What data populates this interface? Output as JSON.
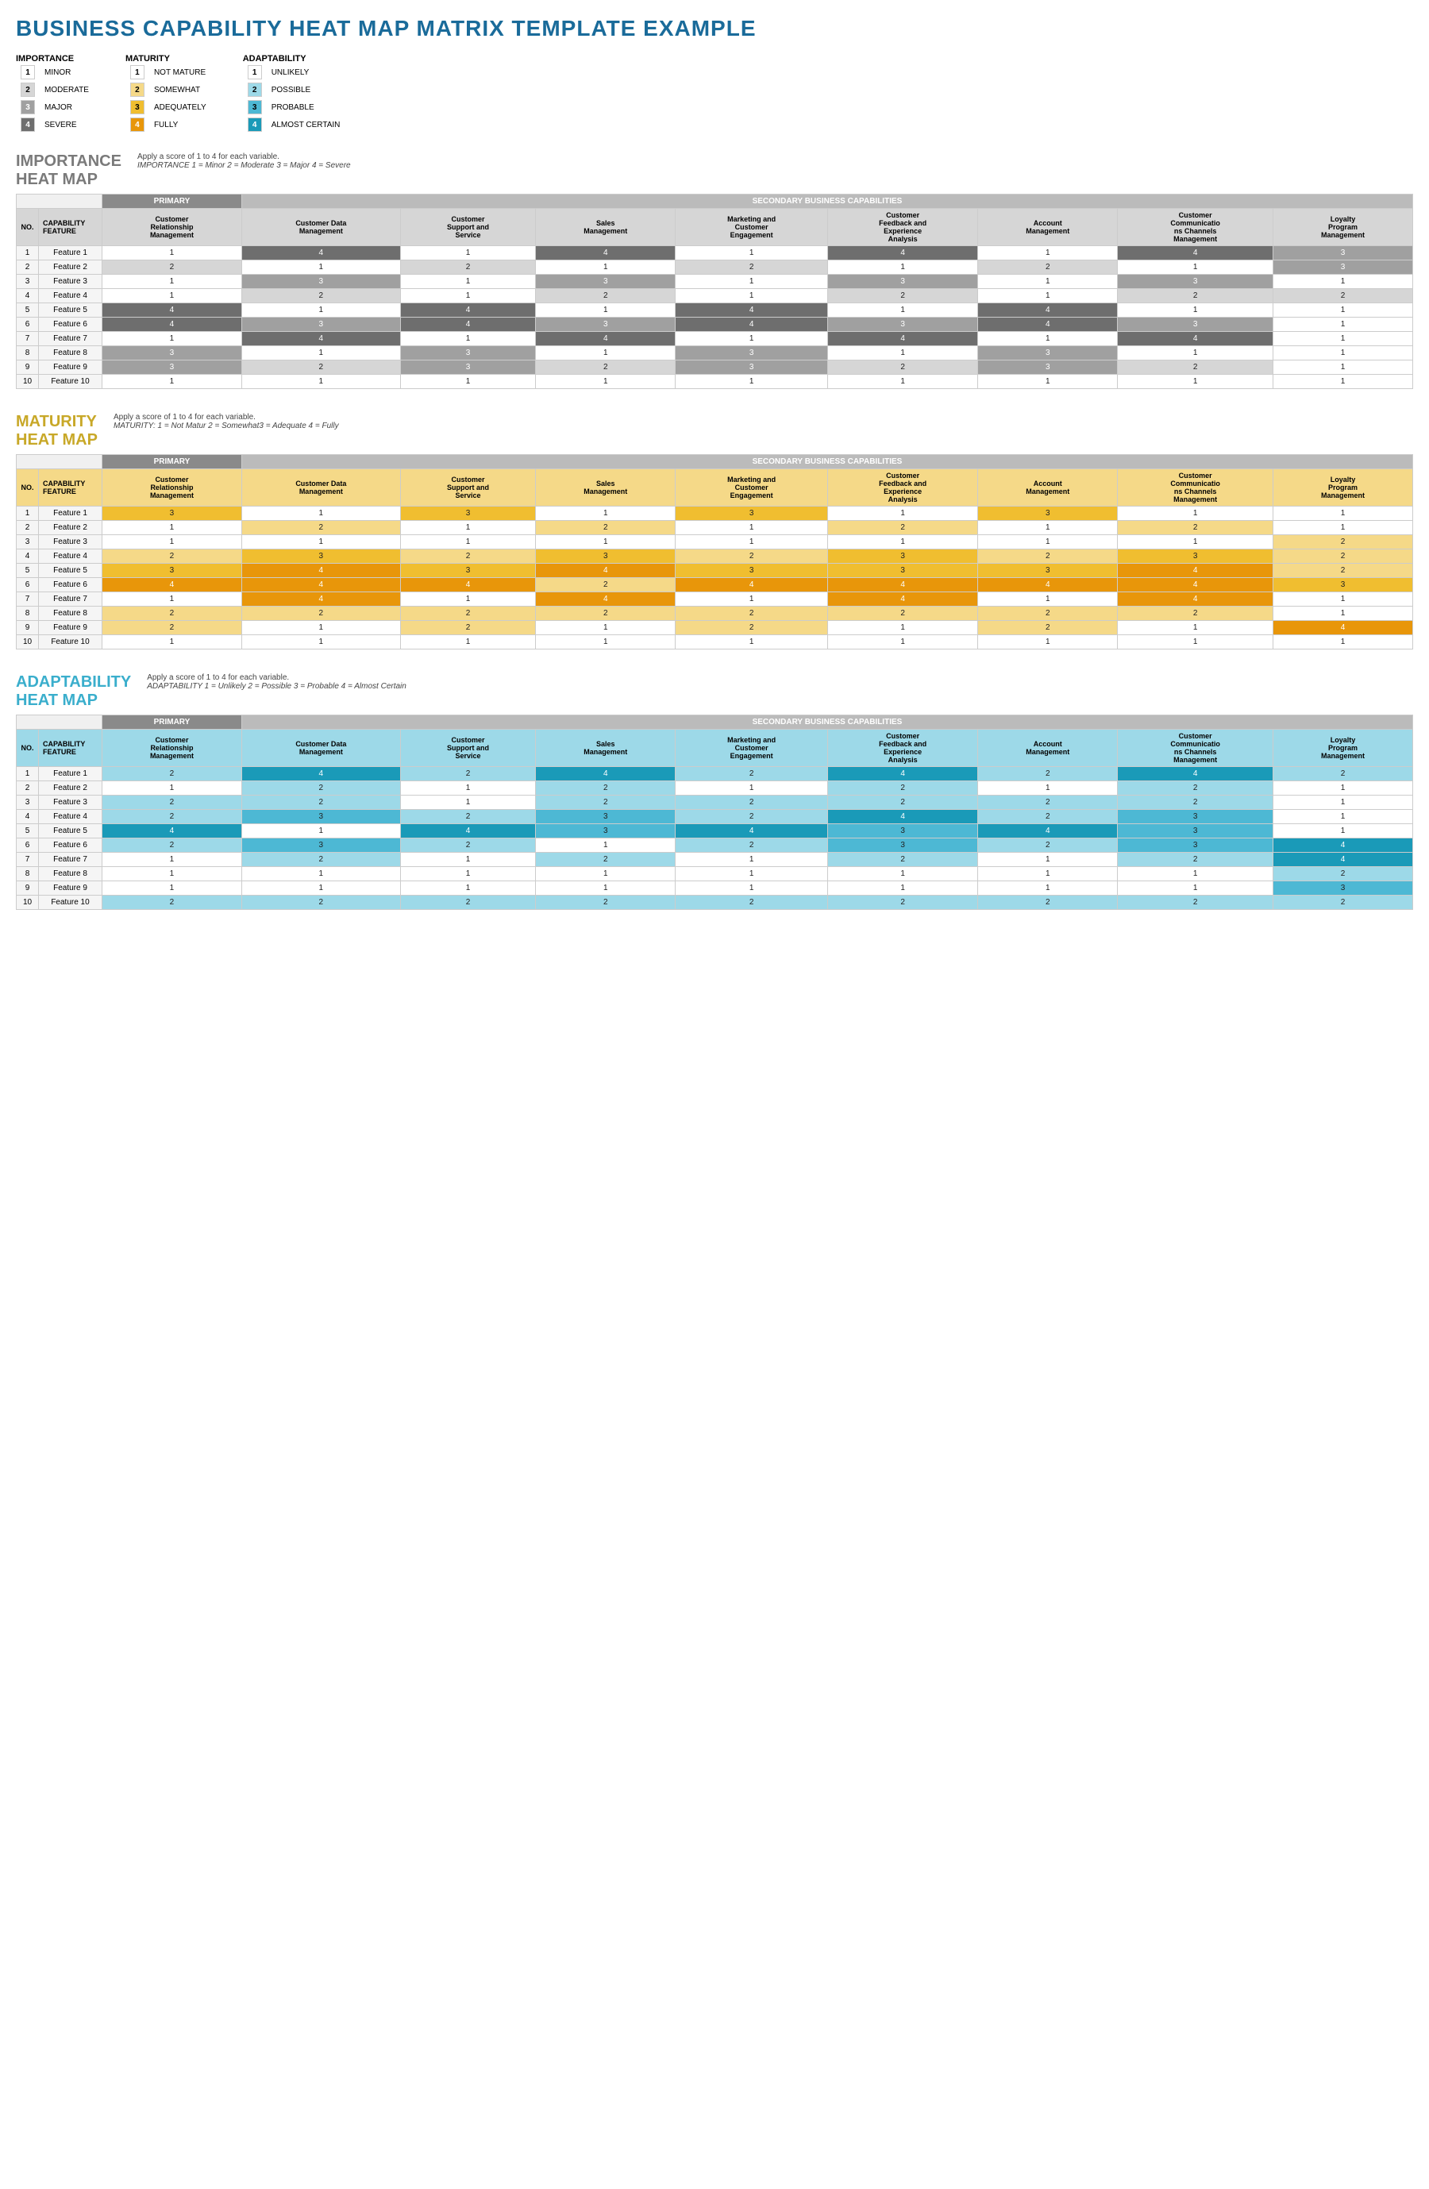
{
  "title": "BUSINESS CAPABILITY HEAT MAP MATRIX TEMPLATE EXAMPLE",
  "legends": {
    "importance": {
      "label": "IMPORTANCE",
      "items": [
        {
          "num": "1",
          "text": "MINOR",
          "bg": "#ffffff",
          "border": "#ccc"
        },
        {
          "num": "2",
          "text": "MODERATE",
          "bg": "#d6d6d6",
          "border": "#ccc"
        },
        {
          "num": "3",
          "text": "MAJOR",
          "bg": "#a0a0a0",
          "border": "#ccc"
        },
        {
          "num": "4",
          "text": "SEVERE",
          "bg": "#6e6e6e",
          "border": "#ccc"
        }
      ]
    },
    "maturity": {
      "label": "MATURITY",
      "items": [
        {
          "num": "1",
          "text": "NOT MATURE",
          "bg": "#ffffff",
          "border": "#ccc"
        },
        {
          "num": "2",
          "text": "SOMEWHAT",
          "bg": "#f5d988",
          "border": "#ccc"
        },
        {
          "num": "3",
          "text": "ADEQUATELY",
          "bg": "#f0be30",
          "border": "#ccc"
        },
        {
          "num": "4",
          "text": "FULLY",
          "bg": "#e8960a",
          "border": "#ccc"
        }
      ]
    },
    "adaptability": {
      "label": "ADAPTABILITY",
      "items": [
        {
          "num": "1",
          "text": "UNLIKELY",
          "bg": "#ffffff",
          "border": "#ccc"
        },
        {
          "num": "2",
          "text": "POSSIBLE",
          "bg": "#9dd9e8",
          "border": "#ccc"
        },
        {
          "num": "3",
          "text": "PROBABLE",
          "bg": "#4db8d4",
          "border": "#ccc"
        },
        {
          "num": "4",
          "text": "ALMOST CERTAIN",
          "bg": "#1a9ab8",
          "border": "#ccc"
        }
      ]
    }
  },
  "columns": [
    "Customer Relationship Management",
    "Customer Data Management",
    "Customer Support and Service",
    "Sales Management",
    "Marketing and Customer Engagement",
    "Customer Feedback and Experience Analysis",
    "Account Management",
    "Customer Communications Channels Management",
    "Loyalty Program Management"
  ],
  "features": [
    "Feature 1",
    "Feature 2",
    "Feature 3",
    "Feature 4",
    "Feature 5",
    "Feature 6",
    "Feature 7",
    "Feature 8",
    "Feature 9",
    "Feature 10"
  ],
  "importance": {
    "title_line1": "IMPORTANCE",
    "title_line2": "HEAT MAP",
    "apply_text": "Apply a score of 1 to 4 for each variable.",
    "scale_text": "IMPORTANCE 1 = Minor    2 = Moderate  3 = Major    4 = Severe",
    "data": [
      [
        1,
        4,
        1,
        4,
        1,
        4,
        1,
        4,
        3
      ],
      [
        2,
        1,
        2,
        1,
        2,
        1,
        2,
        1,
        3
      ],
      [
        1,
        3,
        1,
        3,
        1,
        3,
        1,
        3,
        1
      ],
      [
        1,
        2,
        1,
        2,
        1,
        2,
        1,
        2,
        2
      ],
      [
        4,
        1,
        4,
        1,
        4,
        1,
        4,
        1,
        1
      ],
      [
        4,
        3,
        4,
        3,
        4,
        3,
        4,
        3,
        1
      ],
      [
        1,
        4,
        1,
        4,
        1,
        4,
        1,
        4,
        1
      ],
      [
        3,
        1,
        3,
        1,
        3,
        1,
        3,
        1,
        1
      ],
      [
        3,
        2,
        3,
        2,
        3,
        2,
        3,
        2,
        1
      ],
      [
        1,
        1,
        1,
        1,
        1,
        1,
        1,
        1,
        1
      ]
    ]
  },
  "maturity": {
    "title_line1": "MATURITY",
    "title_line2": "HEAT MAP",
    "apply_text": "Apply a score of 1 to 4 for each variable.",
    "scale_text": "MATURITY:   1 = Not Matur  2 = Somewhat3 = Adequate  4 = Fully",
    "data": [
      [
        3,
        1,
        3,
        1,
        3,
        1,
        3,
        1,
        1
      ],
      [
        1,
        2,
        1,
        2,
        1,
        2,
        1,
        2,
        1
      ],
      [
        1,
        1,
        1,
        1,
        1,
        1,
        1,
        1,
        2
      ],
      [
        2,
        3,
        2,
        3,
        2,
        3,
        2,
        3,
        2
      ],
      [
        3,
        4,
        3,
        4,
        3,
        3,
        3,
        4,
        2
      ],
      [
        4,
        4,
        4,
        2,
        4,
        4,
        4,
        4,
        3
      ],
      [
        1,
        4,
        1,
        4,
        1,
        4,
        1,
        4,
        1
      ],
      [
        2,
        2,
        2,
        2,
        2,
        2,
        2,
        2,
        1
      ],
      [
        2,
        1,
        2,
        1,
        2,
        1,
        2,
        1,
        4
      ],
      [
        1,
        1,
        1,
        1,
        1,
        1,
        1,
        1,
        1
      ]
    ]
  },
  "adaptability": {
    "title_line1": "ADAPTABILITY",
    "title_line2": "HEAT MAP",
    "apply_text": "Apply a score of 1 to 4 for each variable.",
    "scale_text": "ADAPTABILITY  1 = Unlikely   2 = Possible   3 = Probable  4 = Almost Certain",
    "data": [
      [
        2,
        4,
        2,
        4,
        2,
        4,
        2,
        4,
        2
      ],
      [
        1,
        2,
        1,
        2,
        1,
        2,
        1,
        2,
        1
      ],
      [
        2,
        2,
        1,
        2,
        2,
        2,
        2,
        2,
        1
      ],
      [
        2,
        3,
        2,
        3,
        2,
        4,
        2,
        3,
        1
      ],
      [
        4,
        1,
        4,
        3,
        4,
        3,
        4,
        3,
        1
      ],
      [
        2,
        3,
        2,
        1,
        2,
        3,
        2,
        3,
        4
      ],
      [
        1,
        2,
        1,
        2,
        1,
        2,
        1,
        2,
        4
      ],
      [
        1,
        1,
        1,
        1,
        1,
        1,
        1,
        1,
        2
      ],
      [
        1,
        1,
        1,
        1,
        1,
        1,
        1,
        1,
        3
      ],
      [
        2,
        2,
        2,
        2,
        2,
        2,
        2,
        2,
        2
      ]
    ]
  }
}
